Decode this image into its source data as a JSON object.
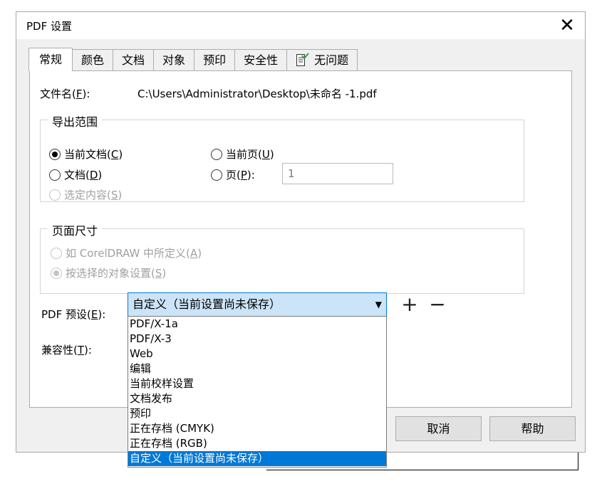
{
  "window": {
    "title": "PDF 设置",
    "close_icon": "close-icon"
  },
  "tabs": [
    {
      "label": "常规",
      "active": true
    },
    {
      "label": "颜色"
    },
    {
      "label": "文档"
    },
    {
      "label": "对象"
    },
    {
      "label": "预印"
    },
    {
      "label": "安全性"
    },
    {
      "label": "无问题",
      "icon": "document-check-icon"
    }
  ],
  "general": {
    "filename_label": "文件名(",
    "filename_key": "F",
    "filename_label_end": "):",
    "filename_value": "C:\\Users\\Administrator\\Desktop\\未命名 -1.pdf",
    "export_range": {
      "legend": "导出范围",
      "current_doc": {
        "label": "当前文档(",
        "key": "C",
        "end": ")",
        "checked": true
      },
      "current_page": {
        "label": "当前页(",
        "key": "U",
        "end": ")"
      },
      "docs": {
        "label": "文档(",
        "key": "D",
        "end": ")"
      },
      "pages": {
        "label": "页(",
        "key": "P",
        "end": "):"
      },
      "pages_value": "1",
      "selection": {
        "label": "选定内容(",
        "key": "S",
        "end": ")",
        "disabled": true
      }
    },
    "page_size": {
      "legend": "页面尺寸",
      "as_defined": {
        "label": "如 CorelDRAW 中所定义(",
        "key": "A",
        "end": ")",
        "disabled": true
      },
      "by_object": {
        "label": "按选择的对象设置(",
        "key": "S",
        "end": ")",
        "disabled": true,
        "checked": true
      }
    },
    "preset_label": "PDF 预设(",
    "preset_key": "E",
    "preset_label_end": "):",
    "preset_value": "自定义（当前设置尚未保存）",
    "compat_label": "兼容性(",
    "compat_key": "T",
    "compat_label_end": "):",
    "plus": "+",
    "minus": "−"
  },
  "buttons": {
    "cancel": "取消",
    "help": "帮助"
  },
  "dropdown": {
    "items": [
      "PDF/X-1a",
      "PDF/X-3",
      "Web",
      "编辑",
      "当前校样设置",
      "文档发布",
      "预印",
      "正在存档 (CMYK)",
      "正在存档 (RGB)",
      "自定义（当前设置尚未保存）"
    ],
    "selected_index": 9
  }
}
